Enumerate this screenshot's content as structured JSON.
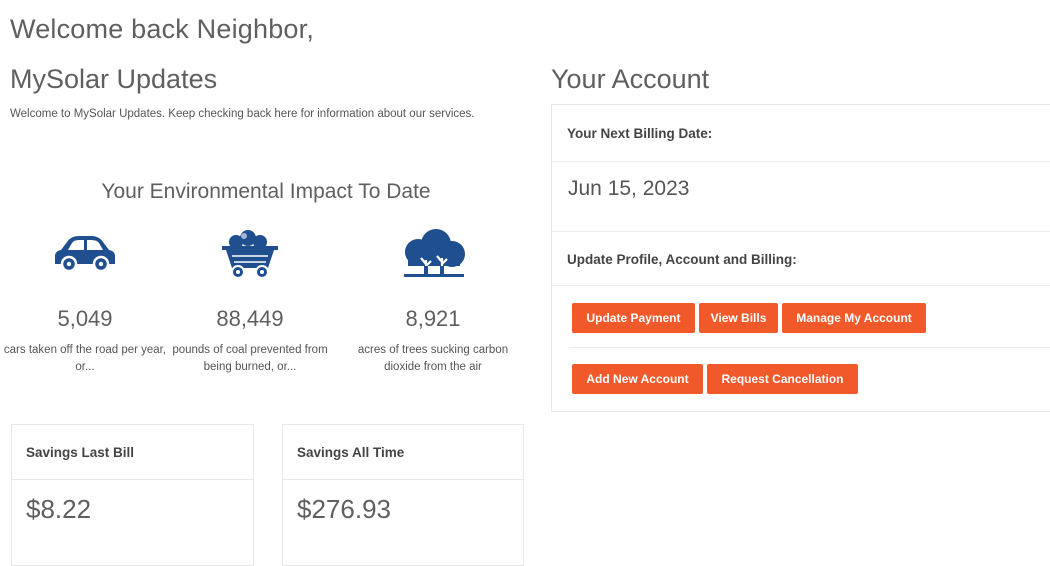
{
  "header": {
    "welcome": "Welcome back Neighbor,"
  },
  "updates": {
    "title": "MySolar Updates",
    "text": "Welcome to MySolar Updates. Keep checking back here for information about our services."
  },
  "impact": {
    "title": "Your Environmental Impact To Date",
    "items": [
      {
        "icon": "car-icon",
        "value": "5,049",
        "desc": "cars taken off the road per year, or..."
      },
      {
        "icon": "coal-cart-icon",
        "value": "88,449",
        "desc": "pounds of coal prevented from being burned, or..."
      },
      {
        "icon": "trees-icon",
        "value": "8,921",
        "desc": "acres of trees sucking carbon dioxide from the air"
      }
    ]
  },
  "savings": {
    "last_bill": {
      "label": "Savings Last Bill",
      "value": "$8.22"
    },
    "all_time": {
      "label": "Savings All Time",
      "value": "$276.93"
    }
  },
  "account": {
    "title": "Your Account",
    "next_billing_label": "Your Next Billing Date:",
    "next_billing_date": "Jun 15, 2023",
    "update_label": "Update Profile, Account and Billing:",
    "buttons": {
      "update_payment": "Update Payment",
      "view_bills": "View Bills",
      "manage_account": "Manage My Account",
      "add_account": "Add New Account",
      "request_cancellation": "Request Cancellation"
    }
  },
  "colors": {
    "accent": "#f1592a",
    "icon": "#1f4f8f",
    "text": "#555555"
  }
}
